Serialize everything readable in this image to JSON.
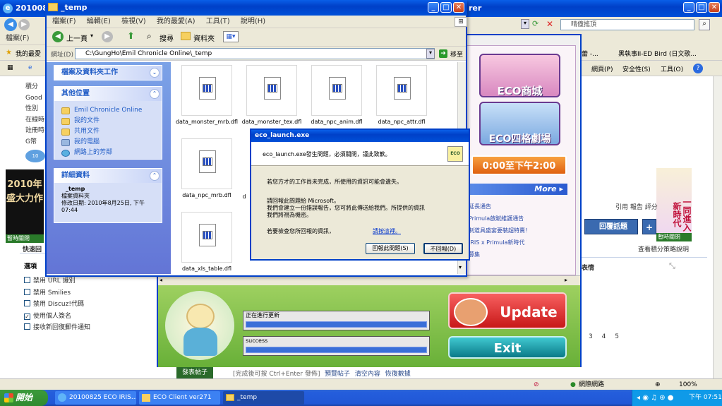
{
  "ie": {
    "title_partial": "20100825",
    "title_right_partial": "rer",
    "menu_left": [
      "檔案(F)",
      "編輯"
    ],
    "favorites_label": "我的最愛",
    "search_placeholder": "晴僮搖頂",
    "fav_links": [
      "瑪莎蕾 -...",
      "黑執事II-ED Bird (日文歌..."
    ],
    "cmd_items": [
      "網頁(P)",
      "安全性(S)",
      "工具(O)"
    ],
    "left_partial": [
      "積分",
      "Good",
      "性別",
      "在線時",
      "註冊時",
      "G幣"
    ],
    "ad_text": "2010年 盛大力作",
    "ad_close": "暫時關閉",
    "right_ad_text": "一同進入新時代",
    "right_ad_close": "暫時關閉",
    "reply_btn": "回覆話題",
    "links_row": "引用 報告 評分",
    "rules_link": "查看積分策略說明",
    "heading_tail": "表情",
    "pages": [
      "3",
      "4",
      "5"
    ],
    "quick_reply": "快速回",
    "options_title": "選項",
    "options": [
      {
        "label": "禁用 URL 識別",
        "checked": false
      },
      {
        "label": "禁用 Smilies",
        "checked": false
      },
      {
        "label": "禁用 Discuz!代碼",
        "checked": false
      },
      {
        "label": "使用個人簽名",
        "checked": true
      },
      {
        "label": "接收新回復郵件通知",
        "checked": false
      }
    ],
    "post_btn": "發表帖子",
    "post_hint": "[完成後可按 Ctrl+Enter 發佈]",
    "post_links": [
      "預覽帖子",
      "清空內容",
      "恢復數據"
    ],
    "status_zone": "網際網路",
    "zoom": "100%"
  },
  "explorer": {
    "title": "_temp",
    "menu": [
      "檔案(F)",
      "編輯(E)",
      "檢視(V)",
      "我的最愛(A)",
      "工具(T)",
      "說明(H)"
    ],
    "back_label": "上一頁",
    "search_label": "搜尋",
    "folders_label": "資料夾",
    "address_label": "網址(D)",
    "address_value": "C:\\GungHo\\Emil Chronicle Online\\_temp",
    "go_label": "移至",
    "pane_tasks_title": "檔案及資料夾工作",
    "pane_places_title": "其他位置",
    "places": [
      "Emil Chronicle Online",
      "我的文件",
      "共用文件",
      "我的電腦",
      "網路上的芳鄰"
    ],
    "pane_details_title": "詳細資料",
    "details_name": "_temp",
    "details_type": "檔案資料夾",
    "details_modified": "修改日期: 2010年8月25日, 下午 07:44",
    "files": [
      "data_monster_mrb.dfl",
      "data_monster_tex.dfl",
      "data_npc_anim.dfl",
      "data_npc_attr.dfl",
      "data_npc_mrb.dfl",
      "d",
      "data_xls_table.dfl"
    ]
  },
  "launcher": {
    "promo1": "ECO商城",
    "promo2": "ECO四格劇場",
    "promo_time": "0:00至下午2:00",
    "more": "More ▸",
    "news": [
      "延長通告",
      "Primula啟賦維護通告",
      "制道具盛宴要裝超特賣！",
      "IRIS x Primula新時代",
      "募集"
    ],
    "bar1_label": "正在進行更新",
    "bar2_label": "success",
    "update_btn": "Update",
    "exit_btn": "Exit"
  },
  "dialog": {
    "title": "eco_launch.exe",
    "message": "eco_launch.exe發生問題，必須關閉，謹此致歉。",
    "warning": "若您方才的工作尚未完成，所使用的資訊可能會遺失。",
    "report_l1": "請回報此問題給 Microsoft。",
    "report_l2": "我們會建立一份錯誤報告，您可將此傳送給我們。所提供的資訊",
    "report_l3": "我們將視為機密。",
    "details_q": "若要檢查您所回報的資訊，",
    "details_link": "請按這裡。",
    "send_btn": "回報此問題(S)",
    "dont_send_btn": "不回報(D)",
    "logo": "ECO"
  },
  "taskbar": {
    "start": "開始",
    "tasks": [
      "20100825 ECO IRIS...",
      "ECO Client ver271",
      "_temp"
    ],
    "clock": "下午 07:51"
  },
  "colors": {
    "xp_blue": "#0a5fe8",
    "pane_blue": "#6375d6",
    "update_red": "#d82828",
    "exit_teal": "#1a9aa8"
  }
}
